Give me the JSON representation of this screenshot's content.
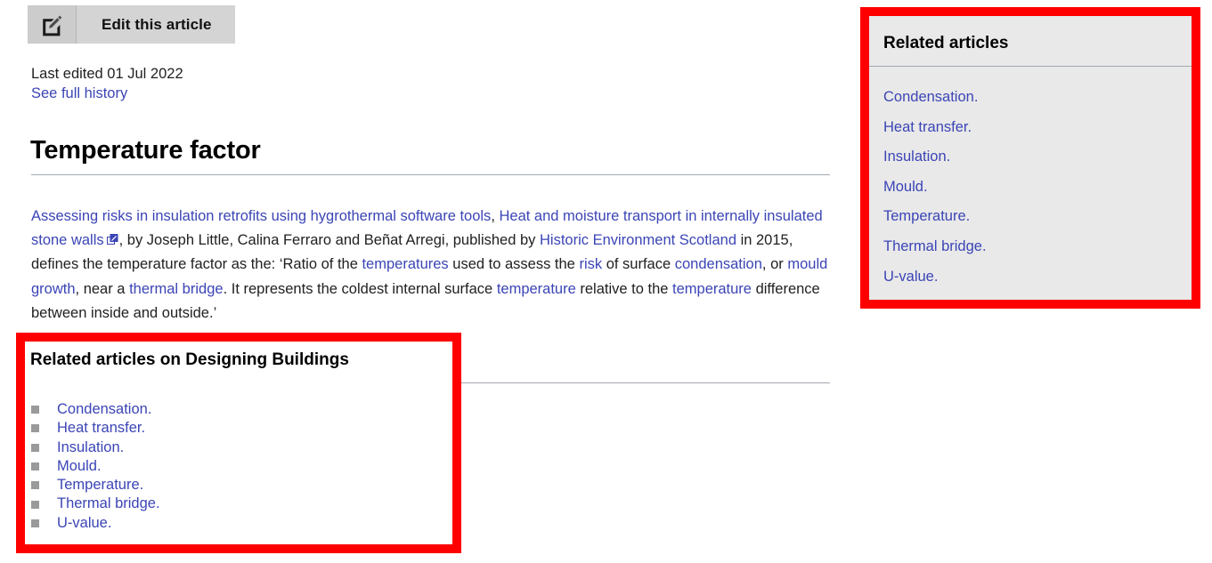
{
  "edit_bar": {
    "label": "Edit this article",
    "icon": "edit-pencil-icon"
  },
  "meta": {
    "last_edited": "Last edited 01 Jul 2022",
    "history_link": "See full history"
  },
  "article": {
    "title": "Temperature factor",
    "paragraph_segments": [
      {
        "text": "Assessing risks in insulation retrofits using hygrothermal software tools",
        "link": true
      },
      {
        "text": ", ",
        "link": false
      },
      {
        "text": "Heat and moisture transport in internally insulated stone walls",
        "link": true
      },
      {
        "text": "EXTICON",
        "link": false
      },
      {
        "text": ", by Joseph Little, Calina Ferraro and Beñat Arregi, published by ",
        "link": false
      },
      {
        "text": "Historic Environment Scotland",
        "link": true
      },
      {
        "text": " in 2015, defines the temperature factor as the: ‘Ratio of the ",
        "link": false
      },
      {
        "text": "temperatures",
        "link": true
      },
      {
        "text": " used to assess the ",
        "link": false
      },
      {
        "text": "risk",
        "link": true
      },
      {
        "text": " of surface ",
        "link": false
      },
      {
        "text": "condensation",
        "link": true
      },
      {
        "text": ", or ",
        "link": false
      },
      {
        "text": "mould growth",
        "link": true
      },
      {
        "text": ", near a ",
        "link": false
      },
      {
        "text": "thermal bridge",
        "link": true
      },
      {
        "text": ". It represents the coldest internal surface ",
        "link": false
      },
      {
        "text": "temperature",
        "link": true
      },
      {
        "text": " relative to the ",
        "link": false
      },
      {
        "text": "temperature",
        "link": true
      },
      {
        "text": " difference between inside and outside.’",
        "link": false
      }
    ]
  },
  "related_designing_buildings": {
    "heading": "Related articles on Designing Buildings",
    "items": [
      "Condensation.",
      "Heat transfer.",
      "Insulation.",
      "Mould.",
      "Temperature.",
      "Thermal bridge.",
      "U-value."
    ]
  },
  "related_panel": {
    "heading": "Related articles",
    "items": [
      "Condensation.",
      "Heat transfer.",
      "Insulation.",
      "Mould.",
      "Temperature.",
      "Thermal bridge.",
      "U-value."
    ]
  },
  "colors": {
    "link": "#3b45b5",
    "highlight_border": "#fe0000",
    "panel_background": "#e9e9e9",
    "edit_bar_background": "#d4d4d4",
    "rule": "#a2a9b1",
    "bullet": "#9a9a9a"
  }
}
